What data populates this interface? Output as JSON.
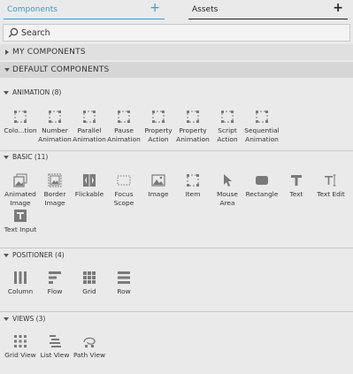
{
  "tabs": {
    "components": {
      "label": "Components",
      "add": "+"
    },
    "assets": {
      "label": "Assets",
      "add": "+"
    }
  },
  "search": {
    "placeholder": "Search"
  },
  "sections": {
    "my_components": "MY COMPONENTS",
    "default_components": "DEFAULT COMPONENTS"
  },
  "categories": {
    "animation": {
      "title": "ANIMATION (8)",
      "items": [
        {
          "label": "Colo...tion",
          "icon": "dashed-square-icon"
        },
        {
          "label": "Number\nAnimation",
          "icon": "dashed-square-icon"
        },
        {
          "label": "Parallel\nAnimation",
          "icon": "dashed-square-icon"
        },
        {
          "label": "Pause\nAnimation",
          "icon": "dashed-square-icon"
        },
        {
          "label": "Property\nAction",
          "icon": "dashed-square-icon"
        },
        {
          "label": "Property\nAnimation",
          "icon": "dashed-square-icon"
        },
        {
          "label": "Script\nAction",
          "icon": "dashed-square-icon"
        },
        {
          "label": "Sequential\nAnimation",
          "icon": "dashed-square-icon"
        }
      ]
    },
    "basic": {
      "title": "BASIC (11)",
      "items": [
        {
          "label": "Animated\nImage",
          "icon": "animated-image-icon"
        },
        {
          "label": "Border\nImage",
          "icon": "border-image-icon"
        },
        {
          "label": "Flickable",
          "icon": "flickable-icon"
        },
        {
          "label": "Focus\nScope",
          "icon": "focus-scope-icon"
        },
        {
          "label": "Image",
          "icon": "image-icon"
        },
        {
          "label": "Item",
          "icon": "item-icon"
        },
        {
          "label": "Mouse\nArea",
          "icon": "mouse-area-icon"
        },
        {
          "label": "Rectangle",
          "icon": "rectangle-icon"
        },
        {
          "label": "Text",
          "icon": "text-icon"
        },
        {
          "label": "Text Edit",
          "icon": "text-edit-icon"
        },
        {
          "label": "Text Input",
          "icon": "text-input-icon"
        }
      ]
    },
    "positioner": {
      "title": "POSITIONER (4)",
      "items": [
        {
          "label": "Column",
          "icon": "column-icon"
        },
        {
          "label": "Flow",
          "icon": "flow-icon"
        },
        {
          "label": "Grid",
          "icon": "grid-icon"
        },
        {
          "label": "Row",
          "icon": "row-icon"
        }
      ]
    },
    "views": {
      "title": "VIEWS (3)",
      "items": [
        {
          "label": "Grid View",
          "icon": "grid-view-icon"
        },
        {
          "label": "List View",
          "icon": "list-view-icon"
        },
        {
          "label": "Path View",
          "icon": "path-view-icon"
        }
      ]
    }
  },
  "colors": {
    "accent": "#2aa1d1",
    "background": "#eaeaea",
    "icon": "#7a7a7a"
  }
}
